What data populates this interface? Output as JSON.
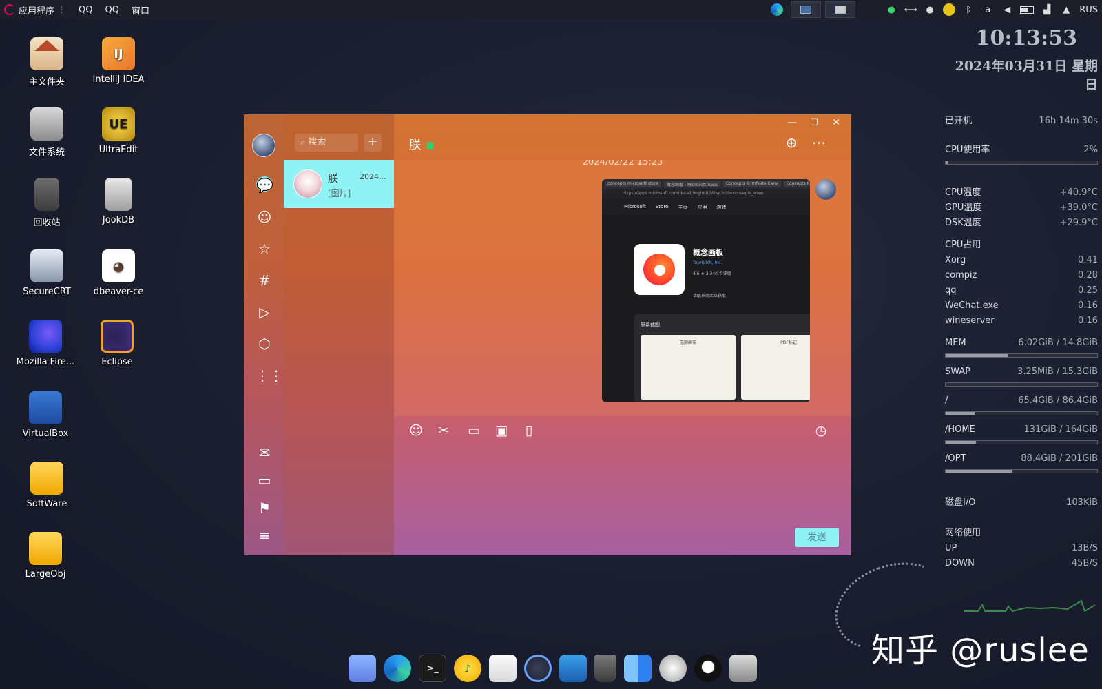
{
  "topbar": {
    "apps_label": "应用程序",
    "menu": [
      "QQ",
      "QQ",
      "窗口"
    ],
    "lang": "RUS"
  },
  "desktop": {
    "icons": [
      {
        "label": "主文件夹",
        "icon": "home-folder-icon"
      },
      {
        "label": "IntelliJ IDEA",
        "icon": "intellij-icon"
      },
      {
        "label": "文件系统",
        "icon": "hard-disk-icon"
      },
      {
        "label": "UltraEdit",
        "icon": "ultraedit-icon"
      },
      {
        "label": "回收站",
        "icon": "trash-icon"
      },
      {
        "label": "JookDB",
        "icon": "database-icon"
      },
      {
        "label": "SecureCRT",
        "icon": "securecrt-icon"
      },
      {
        "label": "dbeaver-ce",
        "icon": "dbeaver-icon"
      },
      {
        "label": "Mozilla Fire...",
        "icon": "firefox-icon"
      },
      {
        "label": "Eclipse",
        "icon": "eclipse-icon"
      },
      {
        "label": "VirtualBox",
        "icon": "virtualbox-icon"
      },
      {
        "label": "SoftWare",
        "icon": "drive-icon"
      },
      {
        "label": "LargeObj",
        "icon": "drive-icon"
      }
    ]
  },
  "conky": {
    "time": "10:13:53",
    "date": "2024年03月31日 星期日",
    "uptime_label": "已开机",
    "uptime_value": "16h 14m 30s",
    "cpu_label": "CPU使用率",
    "cpu_value": "2%",
    "cpu_fraction": 0.02,
    "temps": [
      {
        "label": "CPU温度",
        "value": "+40.9°C"
      },
      {
        "label": "GPU温度",
        "value": "+39.0°C"
      },
      {
        "label": "DSK温度",
        "value": "+29.9°C"
      }
    ],
    "proc_header": "CPU占用",
    "processes": [
      {
        "name": "Xorg",
        "value": "0.41"
      },
      {
        "name": "compiz",
        "value": "0.28"
      },
      {
        "name": "qq",
        "value": "0.25"
      },
      {
        "name": "WeChat.exe",
        "value": "0.16"
      },
      {
        "name": "wineserver",
        "value": "0.16"
      }
    ],
    "mem": [
      {
        "label": "MEM",
        "value": "6.02GiB / 14.8GiB",
        "fraction": 0.41
      },
      {
        "label": "SWAP",
        "value": "3.25MiB / 15.3GiB",
        "fraction": 0.0
      },
      {
        "label": "/",
        "value": "65.4GiB / 86.4GiB",
        "fraction": 0.19
      },
      {
        "label": "/HOME",
        "value": "131GiB / 164GiB",
        "fraction": 0.2
      },
      {
        "label": "/OPT",
        "value": "88.4GiB / 201GiB",
        "fraction": 0.44
      }
    ],
    "disk_io_label": "磁盘I/O",
    "disk_io_value": "103KiB",
    "net_label": "网络使用",
    "up_label": "UP",
    "up_value": "13B/S",
    "down_label": "DOWN",
    "down_value": "45B/S"
  },
  "qq": {
    "search_placeholder": "搜索",
    "add": "+",
    "conversation": {
      "name": "朕",
      "time": "2024...",
      "preview": "[图片]"
    },
    "chat_title": "朕",
    "msg_time": "2024/02/22 15:23",
    "send_label": "发送",
    "screenshot": {
      "tabs": [
        "concepts microsoft store",
        "概念画板 - Microsoft Apps",
        "Concepts 6: Infinite Canv",
        "Concepts 6: 1"
      ],
      "address": "https://apps.microsoft.com/detail/9nglrd0jhthwj?cid=concepts_www",
      "store_nav": [
        "Microsoft",
        "Store",
        "主页",
        "应用",
        "游戏"
      ],
      "app_name": "概念画板",
      "publisher": "TopHatch, Inc.",
      "meta": "4.6 ★  3.34K 个评级",
      "link": "请联系商店以获取",
      "shots_title": "屏幕截图",
      "thumb_captions": [
        "无限画布",
        "PDF标记"
      ]
    }
  },
  "watermark": "知乎 @ruslee"
}
